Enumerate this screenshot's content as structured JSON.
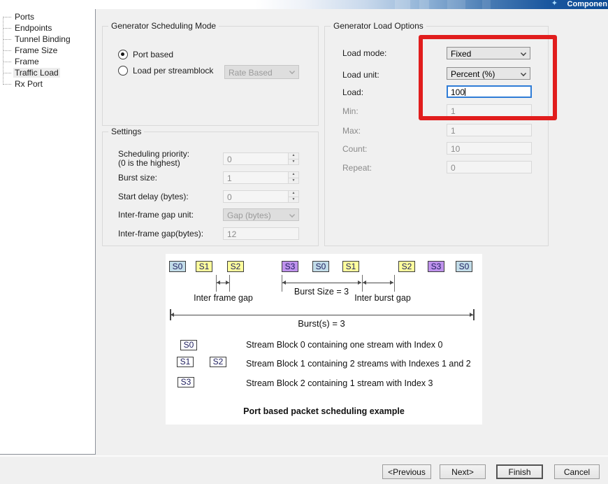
{
  "colors": {
    "annotation": "#e11d1d",
    "focus": "#2f7cd6",
    "s0": "#c2dce8",
    "s1": "#ffff9d",
    "s3": "#bf92ec"
  },
  "icons": {
    "spinner_up": "▲",
    "spinner_down": "▼",
    "star": "✦"
  },
  "banner": {
    "brand": "Componen"
  },
  "sidebar": {
    "items": [
      {
        "label": "Ports",
        "selected": false
      },
      {
        "label": "Endpoints",
        "selected": false
      },
      {
        "label": "Tunnel Binding",
        "selected": false
      },
      {
        "label": "Frame Size",
        "selected": false
      },
      {
        "label": "Frame",
        "selected": false
      },
      {
        "label": "Traffic Load",
        "selected": true
      },
      {
        "label": "Rx Port",
        "selected": false
      }
    ]
  },
  "scheduling_mode": {
    "title": "Generator Scheduling Mode",
    "options": [
      {
        "label": "Port based",
        "selected": true
      },
      {
        "label": "Load per streamblock",
        "selected": false
      }
    ],
    "rate_combo": {
      "value": "Rate Based"
    }
  },
  "settings": {
    "title": "Settings",
    "scheduling_priority": {
      "label": "Scheduling priority:",
      "note": "(0 is the highest)",
      "value": "0"
    },
    "burst_size": {
      "label": "Burst size:",
      "value": "1"
    },
    "start_delay": {
      "label": "Start delay (bytes):",
      "value": "0"
    },
    "ifg_unit": {
      "label": "Inter-frame gap unit:",
      "value": "Gap (bytes)"
    },
    "ifg": {
      "label": "Inter-frame gap(bytes):",
      "value": "12"
    }
  },
  "load_options": {
    "title": "Generator Load Options",
    "load_mode": {
      "label": "Load mode:",
      "value": "Fixed"
    },
    "load_unit": {
      "label": "Load unit:",
      "value": "Percent (%)"
    },
    "load": {
      "label": "Load:",
      "value": "100"
    },
    "min": {
      "label": "Min:",
      "value": "1"
    },
    "max": {
      "label": "Max:",
      "value": "1"
    },
    "count": {
      "label": "Count:",
      "value": "10"
    },
    "repeat": {
      "label": "Repeat:",
      "value": "0"
    }
  },
  "diagram": {
    "sequence": [
      {
        "label": "S0",
        "kind": "s0"
      },
      {
        "label": "S1",
        "kind": "s1"
      },
      {
        "label": "S2",
        "kind": "s1"
      },
      {
        "label": "S3",
        "kind": "s3"
      },
      {
        "label": "S0",
        "kind": "s0"
      },
      {
        "label": "S1",
        "kind": "s1"
      },
      {
        "label": "S2",
        "kind": "s1"
      },
      {
        "label": "S3",
        "kind": "s3"
      },
      {
        "label": "S0",
        "kind": "s0"
      }
    ],
    "inter_frame_gap_label": "Inter frame gap",
    "burst_size_label": "Burst Size = 3",
    "inter_burst_gap_label": "Inter burst gap",
    "bursts_label": "Burst(s) = 3",
    "legend": [
      {
        "boxes": [
          {
            "label": "S0",
            "kind": "s0"
          }
        ],
        "text": "Stream Block 0 containing one stream with Index 0"
      },
      {
        "boxes": [
          {
            "label": "S1",
            "kind": "s1"
          },
          {
            "label": "S2",
            "kind": "s1"
          }
        ],
        "text": "Stream Block 1 containing 2 streams with Indexes 1 and 2"
      },
      {
        "boxes": [
          {
            "label": "S3",
            "kind": "s3"
          }
        ],
        "text": "Stream Block 2 containing 1 stream with Index 3"
      }
    ],
    "caption": "Port based packet scheduling example"
  },
  "buttons": [
    {
      "label": "<Previous",
      "default": false
    },
    {
      "label": "Next>",
      "default": false
    },
    {
      "label": "Finish",
      "default": true
    },
    {
      "label": "Cancel",
      "default": false
    }
  ]
}
